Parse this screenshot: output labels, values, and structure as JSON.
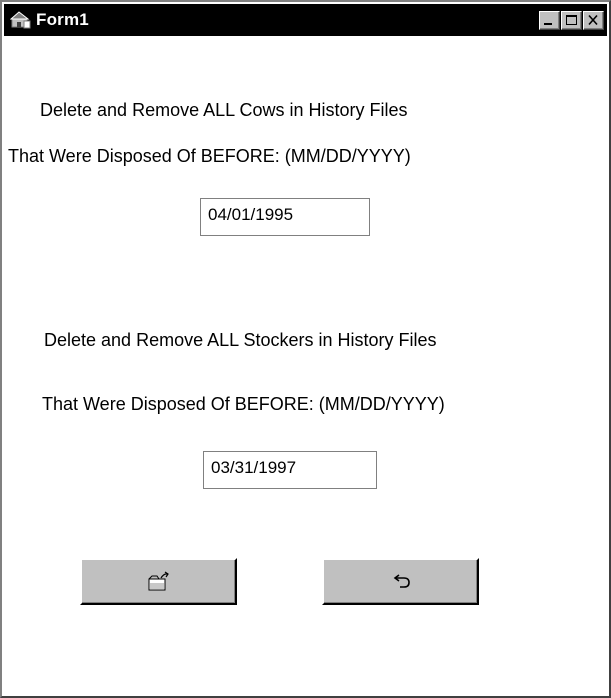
{
  "window": {
    "title": "Form1",
    "title_bar_color": "#000000",
    "face_color": "#c0c0c0"
  },
  "section_cows": {
    "heading": "Delete and Remove ALL Cows in History Files",
    "prompt": "That Were Disposed Of BEFORE: (MM/DD/YYYY)",
    "date_value": "04/01/1995"
  },
  "section_stockers": {
    "heading": "Delete and Remove ALL Stockers in History Files",
    "prompt": "That Were Disposed Of BEFORE: (MM/DD/YYYY)",
    "date_value": "03/31/1997"
  },
  "buttons": {
    "execute_icon": "open-folder-arrow-icon",
    "undo_icon": "undo-arrow-icon"
  }
}
